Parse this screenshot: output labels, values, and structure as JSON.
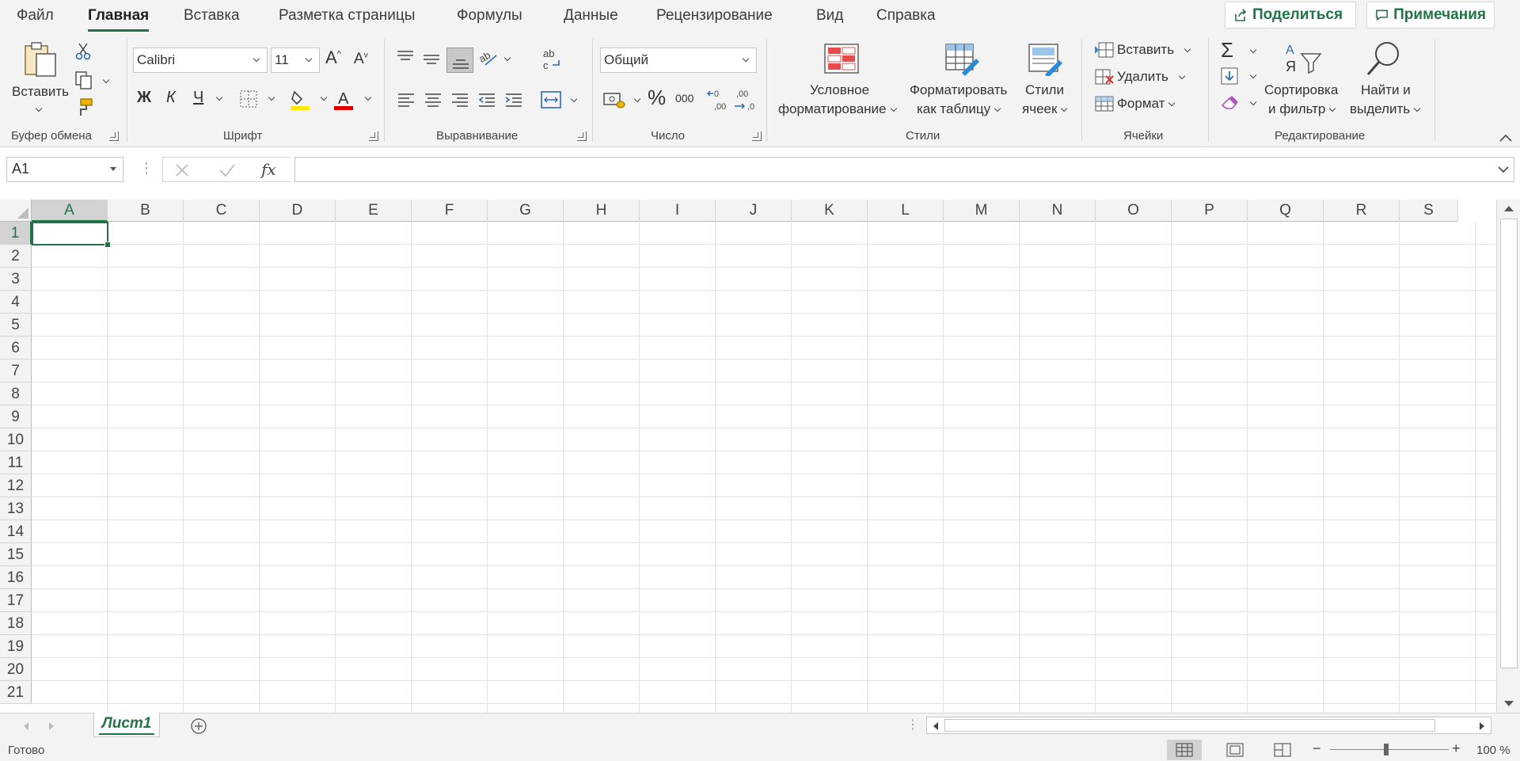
{
  "tabs": [
    "Файл",
    "Главная",
    "Вставка",
    "Разметка страницы",
    "Формулы",
    "Данные",
    "Рецензирование",
    "Вид",
    "Справка"
  ],
  "active_tab": "Главная",
  "header": {
    "share_label": "Поделиться",
    "comments_label": "Примечания"
  },
  "clipboard": {
    "paste_label": "Вставить",
    "group_label": "Буфер обмена"
  },
  "font": {
    "name": "Calibri",
    "size": "11",
    "bold": "Ж",
    "italic": "К",
    "underline": "Ч",
    "group_label": "Шрифт"
  },
  "alignment": {
    "group_label": "Выравнивание"
  },
  "number": {
    "format": "Общий",
    "group_label": "Число",
    "thousands": "000"
  },
  "styles": {
    "conditional_line1": "Условное",
    "conditional_line2": "форматирование",
    "table_line1": "Форматировать",
    "table_line2": "как таблицу",
    "cell_line1": "Стили",
    "cell_line2": "ячеек",
    "group_label": "Стили"
  },
  "cells_group": {
    "insert_label": "Вставить",
    "delete_label": "Удалить",
    "format_label": "Формат",
    "group_label": "Ячейки"
  },
  "editing": {
    "sort_line1": "Сортировка",
    "sort_line2": "и фильтр",
    "find_line1": "Найти и",
    "find_line2": "выделить",
    "group_label": "Редактирование"
  },
  "formula_bar": {
    "name_box": "A1",
    "fx": "fx",
    "formula": ""
  },
  "columns": [
    "A",
    "B",
    "C",
    "D",
    "E",
    "F",
    "G",
    "H",
    "I",
    "J",
    "K",
    "L",
    "M",
    "N",
    "O",
    "P",
    "Q",
    "R",
    "S"
  ],
  "rows": [
    "1",
    "2",
    "3",
    "4",
    "5",
    "6",
    "7",
    "8",
    "9",
    "10",
    "11",
    "12",
    "13",
    "14",
    "15",
    "16",
    "17",
    "18",
    "19",
    "20",
    "21"
  ],
  "sheet": {
    "name": "Лист1"
  },
  "status": {
    "text": "Готово",
    "zoom": "100 %"
  },
  "colors": {
    "accent": "#217346",
    "ribbon_bg": "#f3f3f3"
  }
}
